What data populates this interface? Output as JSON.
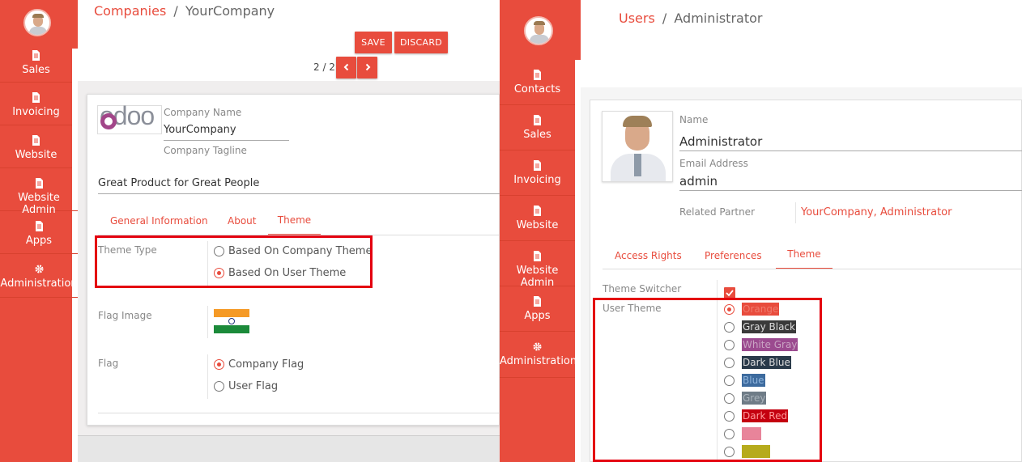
{
  "left": {
    "breadcrumb_parent": "Companies",
    "breadcrumb_sep": "/",
    "breadcrumb_current": "YourCompany",
    "save_label": "SAVE",
    "discard_label": "DISCARD",
    "pager": "2 / 2",
    "sidebar": [
      "Sales",
      "Invoicing",
      "Website",
      "Website Admin",
      "Apps",
      "Administration"
    ],
    "logo_text": "odoo",
    "company_name_label": "Company Name",
    "company_name": "YourCompany",
    "company_tagline_label": "Company Tagline",
    "tagline": "Great Product for Great People",
    "tabs": [
      "General Information",
      "About",
      "Theme"
    ],
    "theme_type_label": "Theme Type",
    "theme_options": [
      "Based On Company Theme",
      "Based On User Theme"
    ],
    "flag_image_label": "Flag Image",
    "flag_label": "Flag",
    "flag_options": [
      "Company Flag",
      "User Flag"
    ]
  },
  "right": {
    "breadcrumb_parent": "Users",
    "breadcrumb_sep": "/",
    "breadcrumb_current": "Administrator",
    "sidebar": [
      "Contacts",
      "Sales",
      "Invoicing",
      "Website",
      "Website Admin",
      "Apps",
      "Administration"
    ],
    "name_label": "Name",
    "name": "Administrator",
    "email_label": "Email Address",
    "email": "admin",
    "partner_label": "Related Partner",
    "partner": "YourCompany, Administrator",
    "tabs": [
      "Access Rights",
      "Preferences",
      "Theme"
    ],
    "theme_switcher_label": "Theme Switcher",
    "user_theme_label": "User Theme",
    "themes": [
      {
        "name": "Orange",
        "color": "#e84c3d",
        "text": "#f07a6c"
      },
      {
        "name": "Gray Black",
        "color": "#3a3a3a",
        "text": "#dddddd"
      },
      {
        "name": "White Gray",
        "color": "#9b4a8f",
        "text": "#c9a3c3"
      },
      {
        "name": "Dark Blue",
        "color": "#2a3a4a",
        "text": "#dddddd"
      },
      {
        "name": "Blue",
        "color": "#3d6b9e",
        "text": "#8fb4dc"
      },
      {
        "name": "Grey",
        "color": "#6f7c87",
        "text": "#aab3bb"
      },
      {
        "name": "Dark Red",
        "color": "#c4000f",
        "text": "#ff9a9a"
      },
      {
        "name": "",
        "color": "#e8849a",
        "text": "#ffffff"
      },
      {
        "name": "",
        "color": "#b6ab1c",
        "text": "#ffffff"
      }
    ]
  },
  "colors": {
    "accent": "#e84c3d",
    "highlight": "#e4000f"
  }
}
